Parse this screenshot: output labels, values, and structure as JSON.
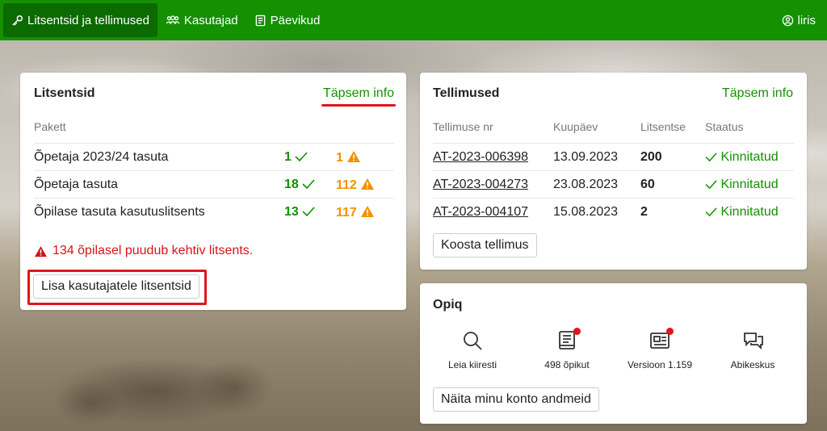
{
  "nav": {
    "licenses": "Litsentsid ja tellimused",
    "users": "Kasutajad",
    "journals": "Päevikud",
    "user": "liris"
  },
  "licenses_card": {
    "title": "Litsentsid",
    "more": "Täpsem info",
    "col_package": "Pakett",
    "rows": [
      {
        "name": "Õpetaja 2023/24 tasuta",
        "ok": "1",
        "warn": "1"
      },
      {
        "name": "Õpetaja tasuta",
        "ok": "18",
        "warn": "112"
      },
      {
        "name": "Õpilase tasuta kasutuslitsents",
        "ok": "13",
        "warn": "117"
      }
    ],
    "warning": "134 õpilasel puudub kehtiv litsents.",
    "add_button": "Lisa kasutajatele litsentsid"
  },
  "orders_card": {
    "title": "Tellimused",
    "more": "Täpsem info",
    "headers": {
      "number": "Tellimuse nr",
      "date": "Kuupäev",
      "licenses": "Litsentse",
      "status": "Staatus"
    },
    "rows": [
      {
        "number": "AT-2023-006398",
        "date": "13.09.2023",
        "licenses": "200",
        "status": "Kinnitatud"
      },
      {
        "number": "AT-2023-004273",
        "date": "23.08.2023",
        "licenses": "60",
        "status": "Kinnitatud"
      },
      {
        "number": "AT-2023-004107",
        "date": "15.08.2023",
        "licenses": "2",
        "status": "Kinnitatud"
      }
    ],
    "compose_button": "Koosta tellimus"
  },
  "opiq_card": {
    "title": "Opiq",
    "items": [
      {
        "label": "Leia kiiresti",
        "icon": "search-icon"
      },
      {
        "label": "498 õpikut",
        "icon": "book-icon"
      },
      {
        "label": "Versioon 1.159",
        "icon": "news-icon"
      },
      {
        "label": "Abikeskus",
        "icon": "chat-icon"
      }
    ],
    "account_button": "Näita minu konto andmeid"
  },
  "colors": {
    "brand_green": "#139100",
    "warning_orange": "#f39200",
    "alert_red": "#e0161c"
  }
}
